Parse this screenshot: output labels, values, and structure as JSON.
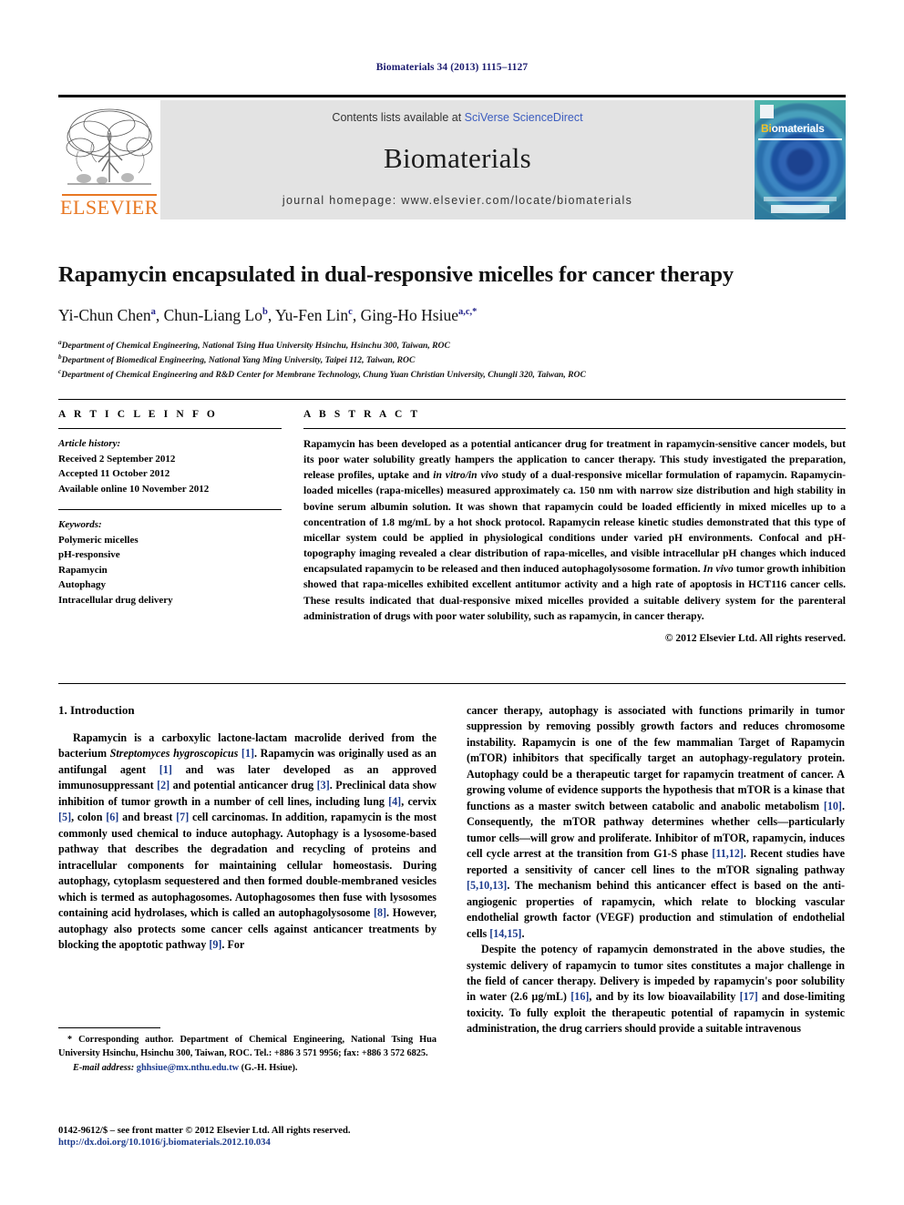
{
  "running_head": "Biomaterials 34 (2013) 1115–1127",
  "masthead": {
    "contents_prefix": "Contents lists available at ",
    "sciencedirect": "SciVerse ScienceDirect",
    "journal_name": "Biomaterials",
    "homepage": "journal homepage: www.elsevier.com/locate/biomaterials",
    "publisher_logo_text": "ELSEVIER",
    "cover_title_first": "Bi",
    "cover_title_rest": "omaterials",
    "accent_orange": "#E87722",
    "link_blue": "#3b5cbf",
    "band_gray": "#e3e3e3"
  },
  "title": "Rapamycin encapsulated in dual-responsive micelles for cancer therapy",
  "authors": [
    {
      "name": "Yi-Chun Chen",
      "sup": "a",
      "sep": ", "
    },
    {
      "name": "Chun-Liang Lo",
      "sup": "b",
      "sep": ", "
    },
    {
      "name": "Yu-Fen Lin",
      "sup": "c",
      "sep": ", "
    },
    {
      "name": "Ging-Ho Hsiue",
      "sup": "a,c,*",
      "sep": ""
    }
  ],
  "affiliations": [
    {
      "marker": "a",
      "text": "Department of Chemical Engineering, National Tsing Hua University Hsinchu, Hsinchu 300, Taiwan, ROC"
    },
    {
      "marker": "b",
      "text": "Department of Biomedical Engineering, National Yang Ming University, Taipei 112, Taiwan, ROC"
    },
    {
      "marker": "c",
      "text": "Department of Chemical Engineering and R&D Center for Membrane Technology, Chung Yuan Christian University, Chungli 320, Taiwan, ROC"
    }
  ],
  "article_info": {
    "heading": "A R T I C L E  I N F O",
    "history_label": "Article history:",
    "history": [
      "Received 2 September 2012",
      "Accepted 11 October 2012",
      "Available online 10 November 2012"
    ],
    "keywords_label": "Keywords:",
    "keywords": [
      "Polymeric micelles",
      "pH-responsive",
      "Rapamycin",
      "Autophagy",
      "Intracellular drug delivery"
    ]
  },
  "abstract": {
    "heading": "A B S T R A C T",
    "paragraphs": [
      "Rapamycin has been developed as a potential anticancer drug for treatment in rapamycin-sensitive cancer models, but its poor water solubility greatly hampers the application to cancer therapy. This study investigated the preparation, release profiles, uptake and <i>in vitro/in vivo</i> study of a dual-responsive micellar formulation of rapamycin. Rapamycin-loaded micelles (rapa-micelles) measured approximately ca. 150 nm with narrow size distribution and high stability in bovine serum albumin solution. It was shown that rapamycin could be loaded efficiently in mixed micelles up to a concentration of 1.8 mg/mL by a hot shock protocol. Rapamycin release kinetic studies demonstrated that this type of micellar system could be applied in physiological conditions under varied pH environments. Confocal and pH-topography imaging revealed a clear distribution of rapa-micelles, and visible intracellular pH changes which induced encapsulated rapamycin to be released and then induced autophagolysosome formation. <i>In vivo</i> tumor growth inhibition showed that rapa-micelles exhibited excellent antitumor activity and a high rate of apoptosis in HCT116 cancer cells. These results indicated that dual-responsive mixed micelles provided a suitable delivery system for the parenteral administration of drugs with poor water solubility, such as rapamycin, in cancer therapy."
    ],
    "copyright": "© 2012 Elsevier Ltd. All rights reserved."
  },
  "body": {
    "section_heading": "1. Introduction",
    "left_paragraphs": [
      "Rapamycin is a carboxylic lactone-lactam macrolide derived from the bacterium <i>Streptomyces hygroscopicus</i> <span class='ref'>[1]</span>. Rapamycin was originally used as an antifungal agent <span class='ref'>[1]</span> and was later developed as an approved immunosuppressant <span class='ref'>[2]</span> and potential anticancer drug <span class='ref'>[3]</span>. Preclinical data show inhibition of tumor growth in a number of cell lines, including lung <span class='ref'>[4]</span>, cervix <span class='ref'>[5]</span>, colon <span class='ref'>[6]</span> and breast <span class='ref'>[7]</span> cell carcinomas. In addition, rapamycin is the most commonly used chemical to induce autophagy. Autophagy is a lysosome-based pathway that describes the degradation and recycling of proteins and intracellular components for maintaining cellular homeostasis. During autophagy, cytoplasm sequestered and then formed double-membraned vesicles which is termed as autophagosomes. Autophagosomes then fuse with lysosomes containing acid hydrolases, which is called an autophagolysosome <span class='ref'>[8]</span>. However, autophagy also protects some cancer cells against anticancer treatments by blocking the apoptotic pathway <span class='ref'>[9]</span>. For"
    ],
    "right_paragraphs": [
      "cancer therapy, autophagy is associated with functions primarily in tumor suppression by removing possibly growth factors and reduces chromosome instability. Rapamycin is one of the few mammalian Target of Rapamycin (mTOR) inhibitors that specifically target an autophagy-regulatory protein. Autophagy could be a therapeutic target for rapamycin treatment of cancer. A growing volume of evidence supports the hypothesis that mTOR is a kinase that functions as a master switch between catabolic and anabolic metabolism <span class='ref'>[10]</span>. Consequently, the mTOR pathway determines whether cells—particularly tumor cells—will grow and proliferate. Inhibitor of mTOR, rapamycin, induces cell cycle arrest at the transition from G1-S phase <span class='ref'>[11,12]</span>. Recent studies have reported a sensitivity of cancer cell lines to the mTOR signaling pathway <span class='ref'>[5,10,13]</span>. The mechanism behind this anticancer effect is based on the anti-angiogenic properties of rapamycin, which relate to blocking vascular endothelial growth factor (VEGF) production and stimulation of endothelial cells <span class='ref'>[14,15]</span>.",
      "Despite the potency of rapamycin demonstrated in the above studies, the systemic delivery of rapamycin to tumor sites constitutes a major challenge in the field of cancer therapy. Delivery is impeded by rapamycin's poor solubility in water (2.6 µg/mL) <span class='ref'>[16]</span>, and by its low bioavailability <span class='ref'>[17]</span> and dose-limiting toxicity. To fully exploit the therapeutic potential of rapamycin in systemic administration, the drug carriers should provide a suitable intravenous"
    ]
  },
  "footnote": {
    "corresponding": "* Corresponding author. Department of Chemical Engineering, National Tsing Hua University Hsinchu, Hsinchu 300, Taiwan, ROC. Tel.: +886 3 571 9956; fax: +886 3 572 6825.",
    "email_label": "E-mail address:",
    "email": "ghhsiue@mx.nthu.edu.tw",
    "email_owner": "(G.-H. Hsiue)."
  },
  "footer": {
    "issn_line": "0142-9612/$ – see front matter © 2012 Elsevier Ltd. All rights reserved.",
    "doi": "http://dx.doi.org/10.1016/j.biomaterials.2012.10.034"
  }
}
